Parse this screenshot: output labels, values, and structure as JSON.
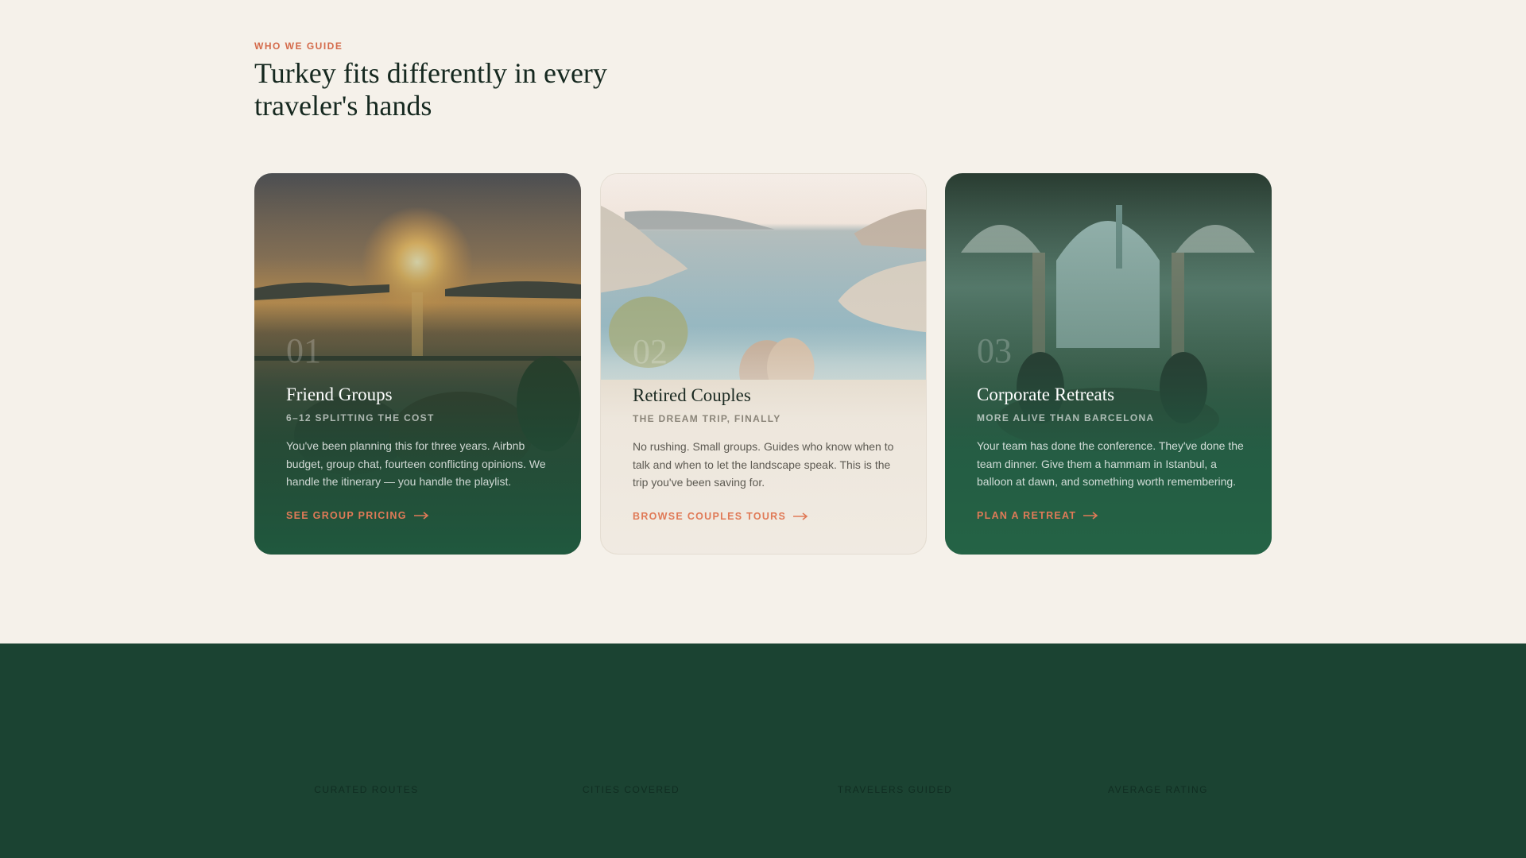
{
  "section": {
    "eyebrow": "WHO WE GUIDE",
    "headline": "Turkey fits differently in every traveler's hands"
  },
  "cards": [
    {
      "number": "01",
      "title": "Friend Groups",
      "subtitle": "6–12 SPLITTING THE COST",
      "body": "You've been planning this for three years. Airbnb budget, group chat, fourteen conflicting opinions. We handle the itinerary — you handle the playlist.",
      "cta": "SEE GROUP PRICING",
      "image_icon": "sunset-bosphorus-dinner-image"
    },
    {
      "number": "02",
      "title": "Retired Couples",
      "subtitle": "THE DREAM TRIP, FINALLY",
      "body": "No rushing. Small groups. Guides who know when to talk and when to let the landscape speak. This is the trip you've been saving for.",
      "cta": "BROWSE COUPLES TOURS",
      "image_icon": "coastal-bay-couple-image"
    },
    {
      "number": "03",
      "title": "Corporate Retreats",
      "subtitle": "MORE ALIVE THAN BARCELONA",
      "body": "Your team has done the conference. They've done the team dinner. Give them a hammam in Istanbul, a balloon at dawn, and something worth remembering.",
      "cta": "PLAN A RETREAT",
      "image_icon": "courtyard-team-dinner-image"
    }
  ],
  "stats": {
    "labels": [
      "CURATED ROUTES",
      "CITIES COVERED",
      "TRAVELERS GUIDED",
      "AVERAGE RATING"
    ]
  },
  "colors": {
    "page_bg": "#f5f1ea",
    "accent": "#d46a4a",
    "heading": "#15281f",
    "band": "#1b4332"
  }
}
